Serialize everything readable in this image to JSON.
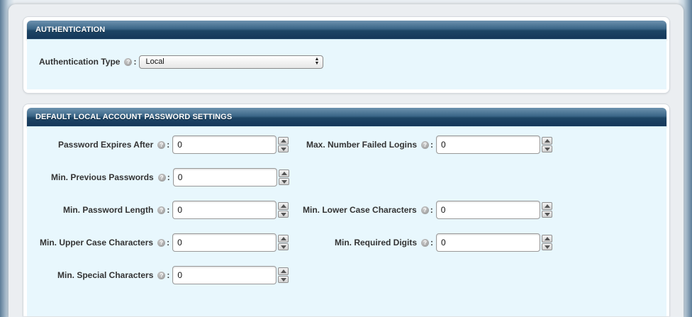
{
  "authentication": {
    "header": "AUTHENTICATION",
    "type_label": "Authentication Type",
    "help": "?",
    "colon": ":",
    "type_value": "Local"
  },
  "password_settings": {
    "header": "DEFAULT LOCAL ACCOUNT PASSWORD SETTINGS",
    "help": "?",
    "colon": ":",
    "fields": {
      "password_expires_after": {
        "label": "Password Expires After",
        "value": "0"
      },
      "max_failed_logins": {
        "label": "Max. Number Failed Logins",
        "value": "0"
      },
      "min_previous_passwords": {
        "label": "Min. Previous Passwords",
        "value": "0"
      },
      "min_password_length": {
        "label": "Min. Password Length",
        "value": "0"
      },
      "min_lower_case": {
        "label": "Min. Lower Case Characters",
        "value": "0"
      },
      "min_upper_case": {
        "label": "Min. Upper Case Characters",
        "value": "0"
      },
      "min_required_digits": {
        "label": "Min. Required Digits",
        "value": "0"
      },
      "min_special_chars": {
        "label": "Min. Special Characters",
        "value": "0"
      }
    }
  }
}
